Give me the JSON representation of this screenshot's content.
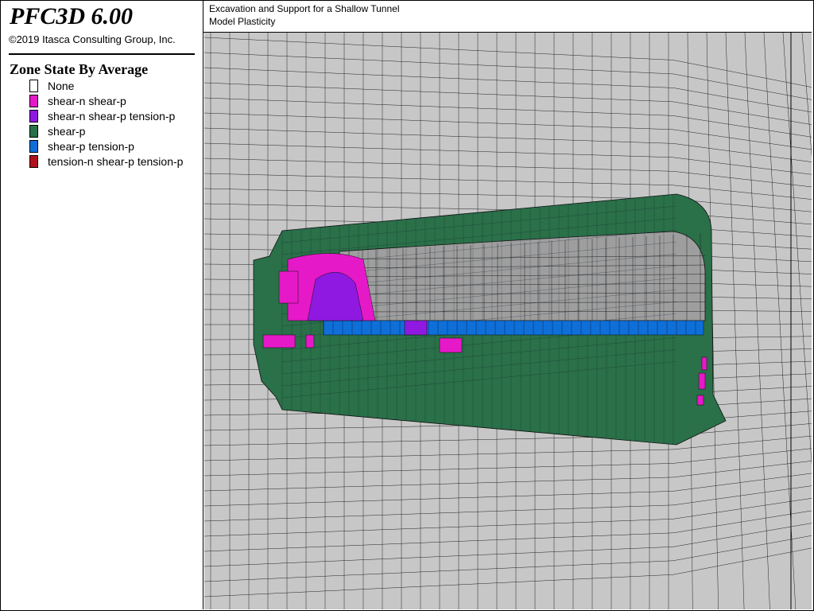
{
  "app": {
    "title": "PFC3D 6.00",
    "copyright": "©2019 Itasca Consulting Group, Inc."
  },
  "legend": {
    "title": "Zone State By Average",
    "items": [
      {
        "label": "None",
        "color": "#ffffff"
      },
      {
        "label": "shear-n shear-p",
        "color": "#e619c8"
      },
      {
        "label": "shear-n shear-p tension-p",
        "color": "#8f19e0"
      },
      {
        "label": "shear-p",
        "color": "#2a7048"
      },
      {
        "label": "shear-p tension-p",
        "color": "#0e6fd8"
      },
      {
        "label": "tension-n shear-p tension-p",
        "color": "#b0121c"
      }
    ]
  },
  "header": {
    "line1": "Excavation and Support for a Shallow Tunnel",
    "line2": "Model Plasticity"
  },
  "viewport": {
    "background_color": "#c7c7c7",
    "grid_color": "#222222",
    "tunnel_interior_color": "#9e9e9e"
  }
}
